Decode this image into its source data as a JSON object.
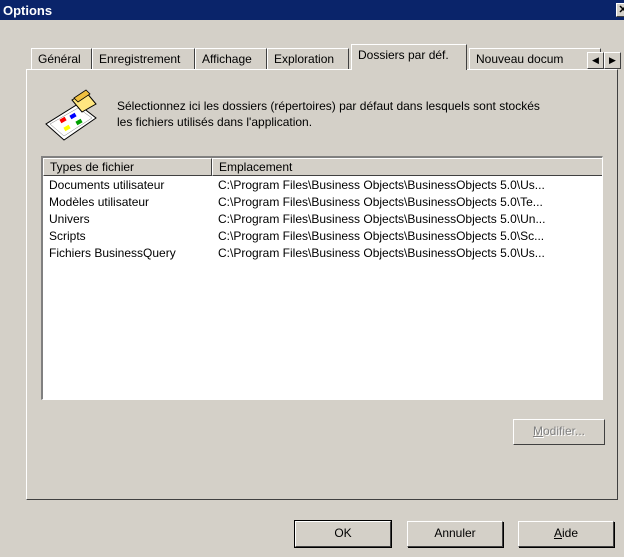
{
  "window": {
    "title": "Options",
    "close_glyph": "✕"
  },
  "tabs": [
    {
      "label": "Général"
    },
    {
      "label": "Enregistrement"
    },
    {
      "label": "Affichage"
    },
    {
      "label": "Exploration"
    },
    {
      "label": "Dossiers par déf."
    },
    {
      "label": "Nouveau docum"
    }
  ],
  "active_tab_index": 4,
  "tab_scroll": {
    "left_glyph": "◀",
    "right_glyph": "▶"
  },
  "description": {
    "icon": "folders-settings-icon",
    "line1": "Sélectionnez ici les dossiers (répertoires) par défaut dans lesquels sont stockés",
    "line2": "les fichiers utilisés dans l'application."
  },
  "list": {
    "columns": [
      "Types de fichier",
      "Emplacement"
    ],
    "rows": [
      {
        "type": "Documents utilisateur",
        "location": "C:\\Program Files\\Business Objects\\BusinessObjects 5.0\\Us..."
      },
      {
        "type": "Modèles utilisateur",
        "location": "C:\\Program Files\\Business Objects\\BusinessObjects 5.0\\Te..."
      },
      {
        "type": "Univers",
        "location": "C:\\Program Files\\Business Objects\\BusinessObjects 5.0\\Un..."
      },
      {
        "type": "Scripts",
        "location": "C:\\Program Files\\Business Objects\\BusinessObjects 5.0\\Sc..."
      },
      {
        "type": "Fichiers BusinessQuery",
        "location": "C:\\Program Files\\Business Objects\\BusinessObjects 5.0\\Us..."
      }
    ]
  },
  "buttons": {
    "modify_u": "M",
    "modify_rest": "odifier...",
    "ok": "OK",
    "cancel": "Annuler",
    "help_u": "A",
    "help_rest": "ide"
  }
}
